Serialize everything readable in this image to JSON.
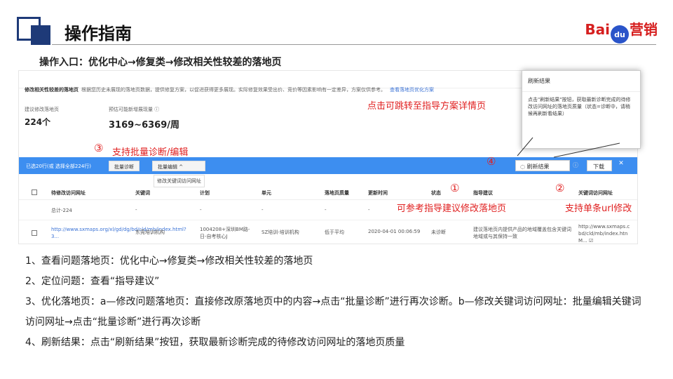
{
  "header": {
    "title": "操作指南",
    "brand_prefix": "Bai",
    "brand_paw": "du",
    "brand_suffix": "营销"
  },
  "entry": "操作入口：优化中心→修复类→修改相关性较差的落地页",
  "shot": {
    "desc_title": "修改相关性较差的落地页",
    "desc_text": "根据您历史未展现的落地页数据，提供修复方案，以促进获得更多展现。实际修复效果受出价、竞价等因素影响有一定差异，方案仅供参考。",
    "desc_link": "查看落地页优化方案",
    "stat1_label": "建议修改落地页",
    "stat1_value": "224个",
    "stat2_label": "预估可能新增展现量 ⓘ",
    "stat2_value": "3169~6369/周",
    "selected_text": "已选20行(或 选择全部224行)",
    "batch_diag": "批量诊断",
    "batch_edit": "批量编辑",
    "batch_edit_option": "修改关键词访问网址",
    "refresh_btn": "◌ 刷新结果",
    "help_icon": "ⓘ",
    "download_btn": "下载",
    "close_icon": "✕",
    "columns": [
      "待修改访问网址",
      "关键词",
      "计划",
      "单元",
      "落地页质量",
      "更新时间",
      "状态",
      "指导建议",
      "关键词访问网址"
    ],
    "total_row": {
      "label": "总计-224",
      "dash": "-"
    },
    "row": {
      "url": "http://www.sxmaps.org/xl/gd/dg/bd/cld/mb/index.html?3...",
      "keyword": "东莞培训机构",
      "plan": "1004208+深圳BM路-日-自考核心J",
      "unit": "SZ培训-培训机构",
      "quality": "低于平均",
      "time": "2020-04-01 00:06:59",
      "status": "未诊断",
      "advice": "建议落地页内提供产品的地域覆盖包含关键词地域或与其保持一致",
      "kw_url": "http://www.sxmaps.c bd/cld/mb/index.htn M... ☑"
    }
  },
  "popup": {
    "title": "刷新结果",
    "body": "点击\"刷新结果\"按钮，获取最新诊断完成的待修改访问网址的落地页质量（状态=诊断中，请稍候再刷新看结果）"
  },
  "annotations": {
    "a3_num": "③",
    "a3_text": "支持批量诊断/编辑",
    "a4_num": "④",
    "a_detail": "点击可跳转至指导方案详情页",
    "a1_num": "①",
    "a1_text": "可参考指导建议修改落地页",
    "a2_num": "②",
    "a2_text": "支持单条url修改"
  },
  "steps": [
    "1、查看问题落地页：优化中心→修复类→修改相关性较差的落地页",
    "2、定位问题：查看“指导建议”",
    "3、优化落地页：a—修改问题落地页：直接修改原落地页中的内容→点击“批量诊断”进行再次诊断。b—修改关键词访问网址：批量编辑关键词访问网址→点击“批量诊断”进行再次诊断",
    "4、刷新结果：点击“刷新结果”按钮，获取最新诊断完成的待修改访问网址的落地页质量"
  ],
  "colors": {
    "accent": "#1e3a78",
    "annotation": "#e02020",
    "bar": "#3d8ef0",
    "brand": "#d61f1f"
  }
}
